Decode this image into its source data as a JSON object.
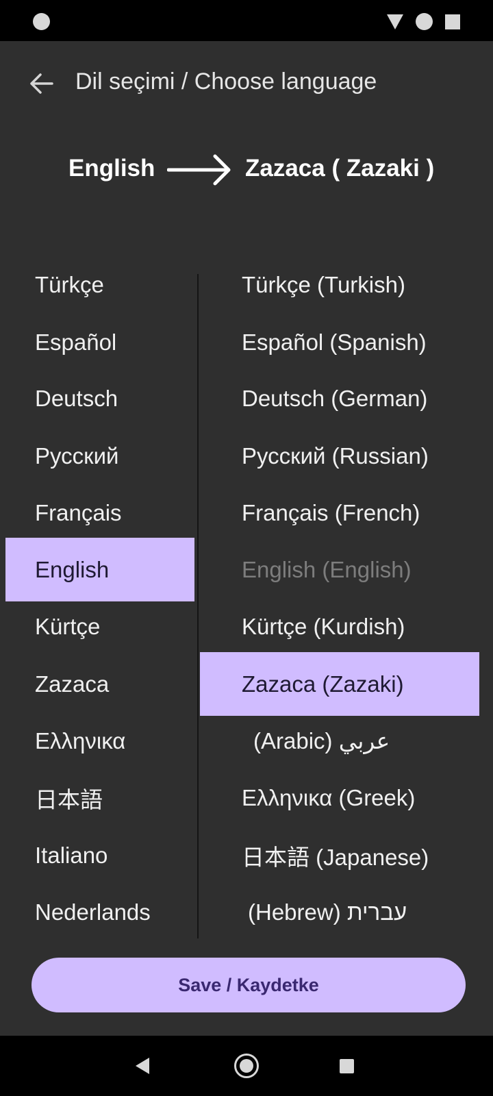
{
  "status_bar": {
    "icons": [
      "notification-dot-icon",
      "wifi-icon",
      "signal-icon",
      "battery-icon"
    ]
  },
  "header": {
    "back_icon": "arrow-back-icon",
    "title": "Dil seçimi / Choose language"
  },
  "direction": {
    "from": "English",
    "arrow_icon": "arrow-right-icon",
    "to": "Zazaca ( Zazaki )"
  },
  "source_languages": {
    "selected": "English",
    "items": [
      {
        "label": "Türkçe"
      },
      {
        "label": "Español"
      },
      {
        "label": "Deutsch"
      },
      {
        "label": "Русский"
      },
      {
        "label": "Français"
      },
      {
        "label": "English"
      },
      {
        "label": "Kürtçe"
      },
      {
        "label": "Zazaca"
      },
      {
        "label": "Ελληνικα"
      },
      {
        "label": "日本語"
      },
      {
        "label": "Italiano"
      },
      {
        "label": "Nederlands"
      }
    ]
  },
  "target_languages": {
    "selected": "Zazaca (Zazaki)",
    "disabled": "English (English)",
    "items": [
      {
        "label": "Türkçe (Turkish)"
      },
      {
        "label": "Español (Spanish)"
      },
      {
        "label": "Deutsch (German)"
      },
      {
        "label": "Русский (Russian)"
      },
      {
        "label": "Français (French)"
      },
      {
        "label": "English (English)"
      },
      {
        "label": "Kürtçe (Kurdish)"
      },
      {
        "label": "Zazaca (Zazaki)"
      },
      {
        "label": "(Arabic) عربي"
      },
      {
        "label": "Ελληνικα (Greek)"
      },
      {
        "label": "日本語 (Japanese)"
      },
      {
        "label": "(Hebrew) עברית"
      }
    ]
  },
  "save_button": {
    "label": "Save / Kaydetke"
  },
  "nav_bar": {
    "icons": [
      "nav-back-icon",
      "nav-home-icon",
      "nav-recents-icon"
    ]
  },
  "colors": {
    "background": "#2f2f2f",
    "accent": "#d0bcff",
    "accent_text": "#3a2870",
    "text": "#f0f0f0",
    "disabled_text": "#7d7d7d"
  }
}
